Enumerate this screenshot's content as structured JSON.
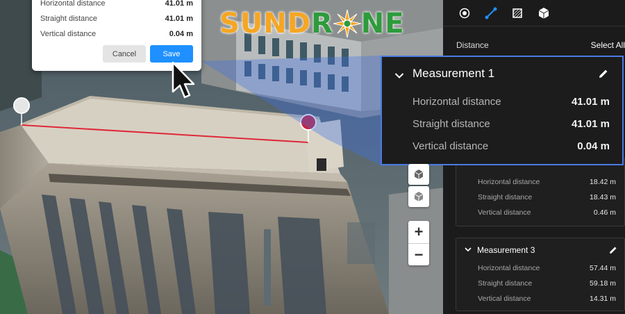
{
  "logo": {
    "part1": "SUND",
    "part2": "R",
    "part3": "NE"
  },
  "dialog": {
    "rows": [
      {
        "label": "Horizontal distance",
        "value": "41.01 m"
      },
      {
        "label": "Straight distance",
        "value": "41.01 m"
      },
      {
        "label": "Vertical distance",
        "value": "0.04 m"
      }
    ],
    "cancel_label": "Cancel",
    "save_label": "Save"
  },
  "panel": {
    "toolbar": [
      "point-tool-icon",
      "distance-tool-icon",
      "area-tool-icon",
      "volume-tool-icon"
    ],
    "distance_label": "Distance",
    "select_all_label": "Select All",
    "measurement2": {
      "rows": [
        {
          "label": "Horizontal distance",
          "value": "18.42 m"
        },
        {
          "label": "Straight distance",
          "value": "18.43 m"
        },
        {
          "label": "Vertical distance",
          "value": "0.46 m"
        }
      ]
    },
    "measurement3": {
      "title": "Measurement 3",
      "rows": [
        {
          "label": "Horizontal distance",
          "value": "57.44 m"
        },
        {
          "label": "Straight distance",
          "value": "59.18 m"
        },
        {
          "label": "Vertical distance",
          "value": "14.31 m"
        }
      ]
    }
  },
  "measurement1": {
    "title": "Measurement 1",
    "rows": [
      {
        "label": "Horizontal distance",
        "value": "41.01 m"
      },
      {
        "label": "Straight distance",
        "value": "41.01 m"
      },
      {
        "label": "Vertical distance",
        "value": "0.04 m"
      }
    ]
  },
  "zoom": {
    "in_label": "+",
    "out_label": "−"
  },
  "colors": {
    "accent": "#1e90ff",
    "highlight_border": "#4a7be6",
    "measure_line": "#e0283a",
    "logo_orange": "#f5a623",
    "logo_green": "#2e9b3c"
  }
}
